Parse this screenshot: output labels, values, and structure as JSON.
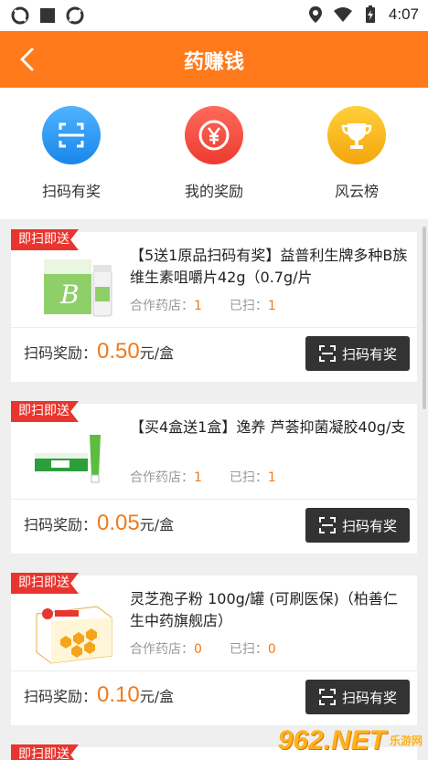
{
  "status_bar": {
    "time": "4:07"
  },
  "header": {
    "title": "药赚钱"
  },
  "shortcuts": [
    {
      "label": "扫码有奖",
      "icon": "scan-icon",
      "color": "#1a86ea"
    },
    {
      "label": "我的奖励",
      "icon": "yen-coin-icon",
      "color": "#ee3a31"
    },
    {
      "label": "风云榜",
      "icon": "trophy-icon",
      "color": "#f5a60c"
    }
  ],
  "products": [
    {
      "badge": "即扫即送",
      "name": "【5送1原品扫码有奖】益普利生牌多种B族维生素咀嚼片42g（0.7g/片",
      "stores_label": "合作药店：",
      "stores_value": "1",
      "scanned_label": "已扫：",
      "scanned_value": "1",
      "reward_label": "扫码奖励：",
      "reward_amount": "0.50",
      "reward_unit": "元/盒",
      "button_label": "扫码有奖"
    },
    {
      "badge": "即扫即送",
      "name": "【买4盒送1盒】逸养 芦荟抑菌凝胶40g/支",
      "stores_label": "合作药店：",
      "stores_value": "1",
      "scanned_label": "已扫：",
      "scanned_value": "1",
      "reward_label": "扫码奖励：",
      "reward_amount": "0.05",
      "reward_unit": "元/盒",
      "button_label": "扫码有奖"
    },
    {
      "badge": "即扫即送",
      "name": "灵芝孢子粉 100g/罐 (可刷医保)（柏善仁生中药旗舰店）",
      "stores_label": "合作药店：",
      "stores_value": "0",
      "scanned_label": "已扫：",
      "scanned_value": "0",
      "reward_label": "扫码奖励：",
      "reward_amount": "0.10",
      "reward_unit": "元/盒",
      "button_label": "扫码有奖"
    }
  ],
  "next_badge": "即扫即送",
  "watermark": {
    "main": "962.NET",
    "sub": "乐游网"
  }
}
